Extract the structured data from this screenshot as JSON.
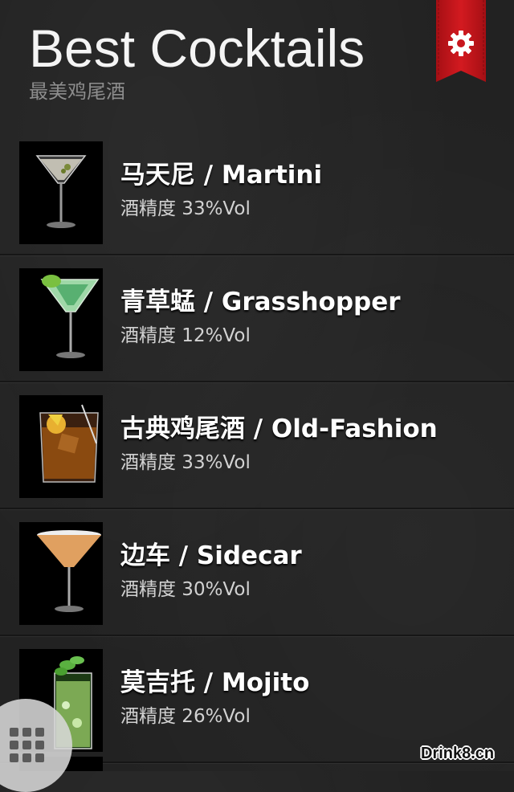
{
  "header": {
    "title": "Best Cocktails",
    "subtitle": "最美鸡尾酒",
    "settings_icon": "gear-icon",
    "ribbon_color": "#c8161d"
  },
  "cocktails": [
    {
      "name": "马天尼 / Martini",
      "abv": "酒精度 33%Vol",
      "glass": "martini",
      "liquid_color": "#d9d6c8"
    },
    {
      "name": "青草蜢 / Grasshopper",
      "abv": "酒精度 12%Vol",
      "glass": "martini",
      "liquid_color": "#9fd8a8"
    },
    {
      "name": "古典鸡尾酒 / Old-Fashion",
      "abv": "酒精度 33%Vol",
      "glass": "rocks",
      "liquid_color": "#8a4a10"
    },
    {
      "name": "边车 / Sidecar",
      "abv": "酒精度 30%Vol",
      "glass": "martini",
      "liquid_color": "#e0a060"
    },
    {
      "name": "莫吉托 / Mojito",
      "abv": "酒精度 26%Vol",
      "glass": "highball",
      "liquid_color": "#9ccf6a"
    }
  ],
  "menu_icon": "grid-menu-icon",
  "watermark": "Drink8.cn"
}
